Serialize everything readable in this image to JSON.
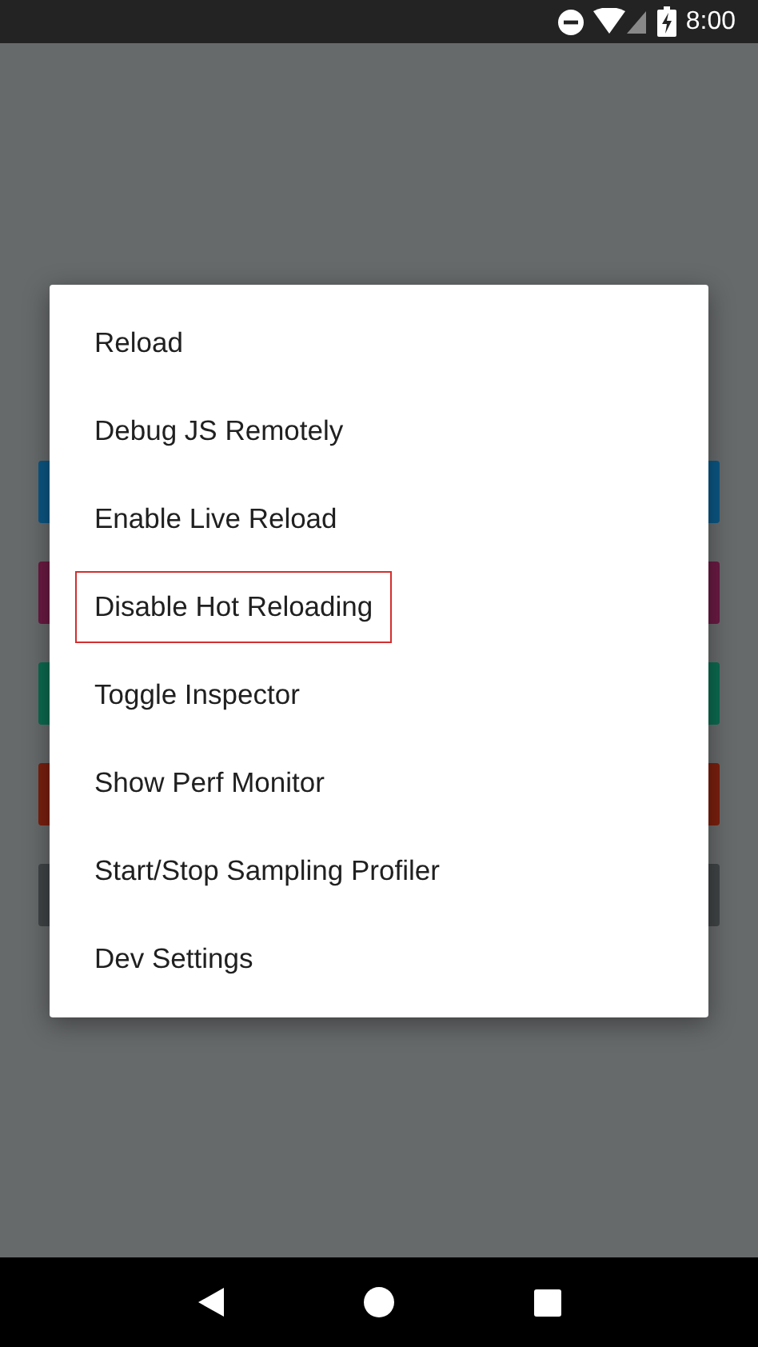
{
  "status_bar": {
    "time": "8:00"
  },
  "background_bars": [
    {
      "color": "#0b5683"
    },
    {
      "color": "#6a1a42"
    },
    {
      "color": "#0c6a4f"
    },
    {
      "color": "#7a1f0e"
    },
    {
      "color": "#404446"
    }
  ],
  "menu": {
    "items": [
      {
        "label": "Reload",
        "highlighted": false
      },
      {
        "label": "Debug JS Remotely",
        "highlighted": false
      },
      {
        "label": "Enable Live Reload",
        "highlighted": false
      },
      {
        "label": "Disable Hot Reloading",
        "highlighted": true
      },
      {
        "label": "Toggle Inspector",
        "highlighted": false
      },
      {
        "label": "Show Perf Monitor",
        "highlighted": false
      },
      {
        "label": "Start/Stop Sampling Profiler",
        "highlighted": false
      },
      {
        "label": "Dev Settings",
        "highlighted": false
      }
    ]
  }
}
